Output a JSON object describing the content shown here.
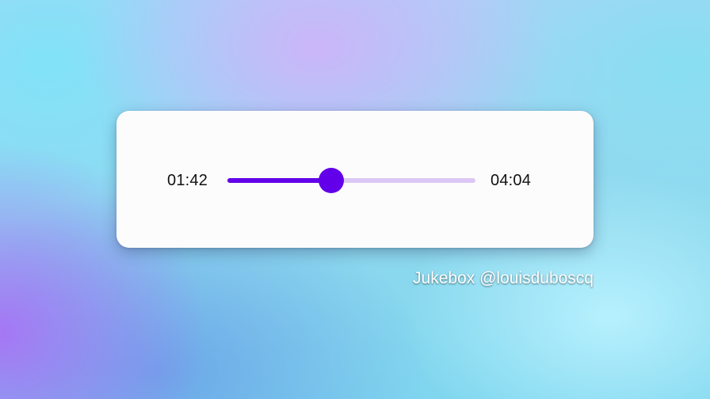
{
  "player": {
    "current_time": "01:42",
    "total_time": "04:04",
    "progress": 0.4176,
    "accent_color": "#6200ea",
    "track_color": "#dcc8f6"
  },
  "credit": "Jukebox @louisduboscq"
}
